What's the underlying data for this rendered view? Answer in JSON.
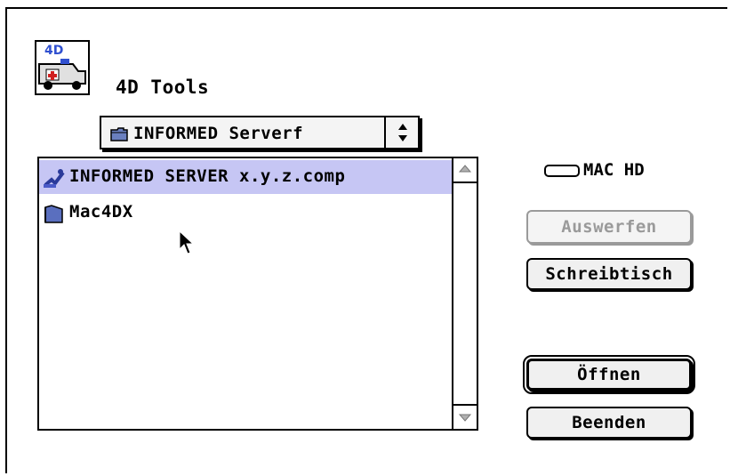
{
  "app": {
    "title": "4D Tools",
    "icon": "4d-tools-ambulance-icon"
  },
  "location_popup": {
    "label": "INFORMED Serverf",
    "icon": "folder-icon",
    "arrows_icon": "updown-arrows-icon"
  },
  "file_list": {
    "items": [
      {
        "label": "INFORMED SERVER x.y.z.comp",
        "icon": "server-app-icon",
        "selected": true
      },
      {
        "label": "Mac4DX",
        "icon": "folder-icon",
        "selected": false
      }
    ]
  },
  "volume": {
    "label": "MAC HD",
    "icon": "disk-icon"
  },
  "buttons": {
    "eject": "Auswerfen",
    "desktop": "Schreibtisch",
    "open": "Öffnen",
    "quit": "Beenden"
  },
  "colors": {
    "selection": "#c6c6f4",
    "disabled": "#9a9a9a"
  }
}
